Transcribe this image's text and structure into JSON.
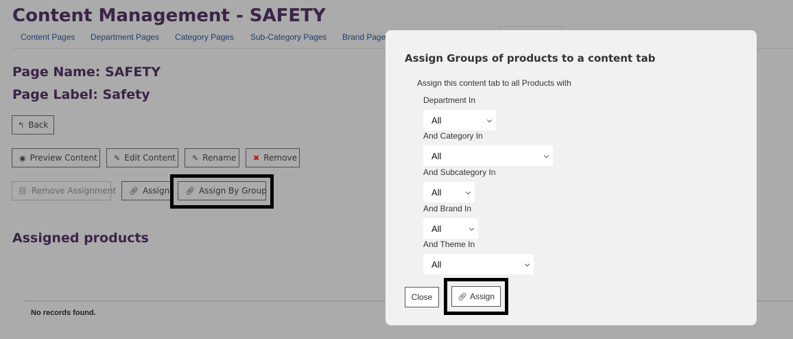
{
  "header": {
    "title": "Content Management - SAFETY",
    "tabs": [
      "Content Pages",
      "Department Pages",
      "Category Pages",
      "Sub-Category Pages",
      "Brand Pages"
    ]
  },
  "page_info": {
    "name": "Page Name: SAFETY",
    "label": "Page Label: Safety"
  },
  "buttons": {
    "back": "Back",
    "preview": "Preview Content",
    "edit": "Edit Content",
    "rename": "Rename",
    "remove": "Remove",
    "remove_assignment": "Remove Assignment",
    "assign": "Assign",
    "assign_by_group": "Assign By Group"
  },
  "assigned": {
    "heading": "Assigned products",
    "empty": "No records found."
  },
  "modal": {
    "title": "Assign Groups of products to a content tab",
    "intro": "Assign this content tab to all Products with",
    "fields": [
      {
        "label": "Department In",
        "value": "All"
      },
      {
        "label": "And Category In",
        "value": "All"
      },
      {
        "label": "And Subcategory In",
        "value": "All"
      },
      {
        "label": "And Brand In",
        "value": "All"
      },
      {
        "label": "And Theme In",
        "value": "All"
      }
    ],
    "close_label": "Close",
    "assign_label": "Assign"
  },
  "colors": {
    "heading": "#3a2448",
    "tab_link": "#1e3f6e",
    "overlay": "#ababab",
    "modal_bg": "#f1f1f1"
  }
}
